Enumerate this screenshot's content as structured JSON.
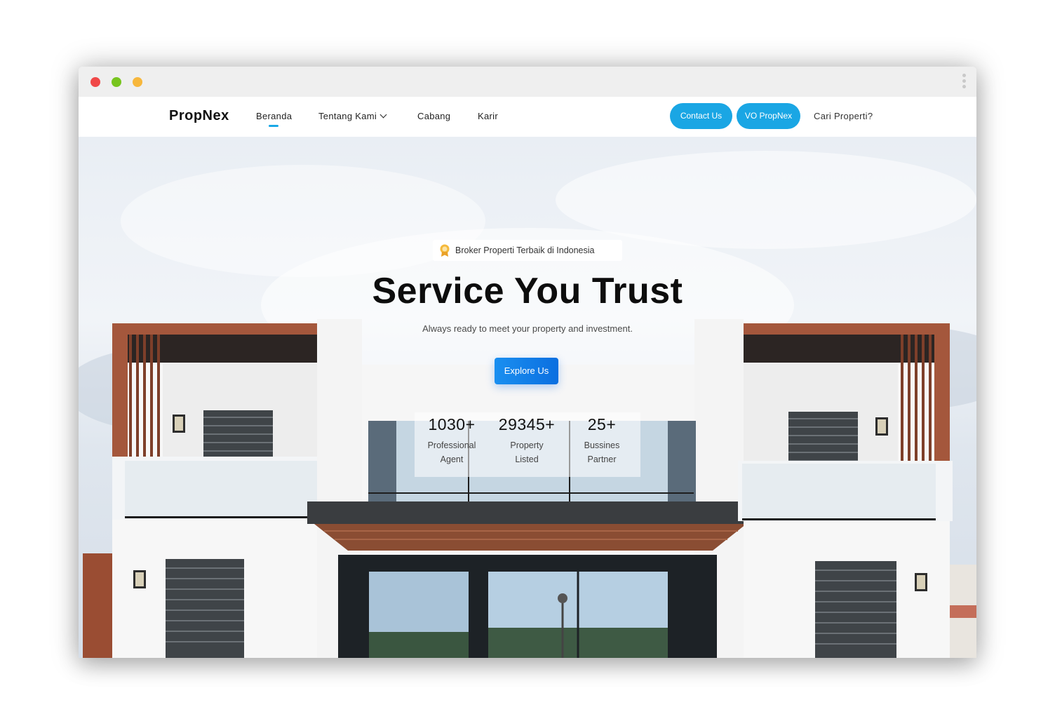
{
  "window": {
    "controls": [
      "close",
      "minimize",
      "maximize"
    ],
    "menu_icon": "kebab-icon"
  },
  "nav": {
    "logo": "PropNex",
    "items": [
      {
        "label": "Beranda",
        "active": true
      },
      {
        "label": "Tentang Kami",
        "has_dropdown": true
      },
      {
        "label": "Cabang"
      },
      {
        "label": "Karir"
      }
    ],
    "contact_label": "Contact Us",
    "vo_label": "VO PropNex",
    "search_label": "Cari Properti?"
  },
  "hero": {
    "badge": "Broker Properti Terbaik di Indonesia",
    "badge_icon": "award-icon",
    "title": "Service You Trust",
    "subtitle": "Always ready to meet your property and investment.",
    "cta_label": "Explore Us",
    "stats": [
      {
        "value": "1030+",
        "label": "Professional Agent"
      },
      {
        "value": "29345+",
        "label": "Property Listed"
      },
      {
        "value": "25+",
        "label": "Bussines Partner"
      }
    ]
  },
  "colors": {
    "accent": "#1aa6e4",
    "cta": "#0b6fe0",
    "wood": "#a4573c"
  }
}
